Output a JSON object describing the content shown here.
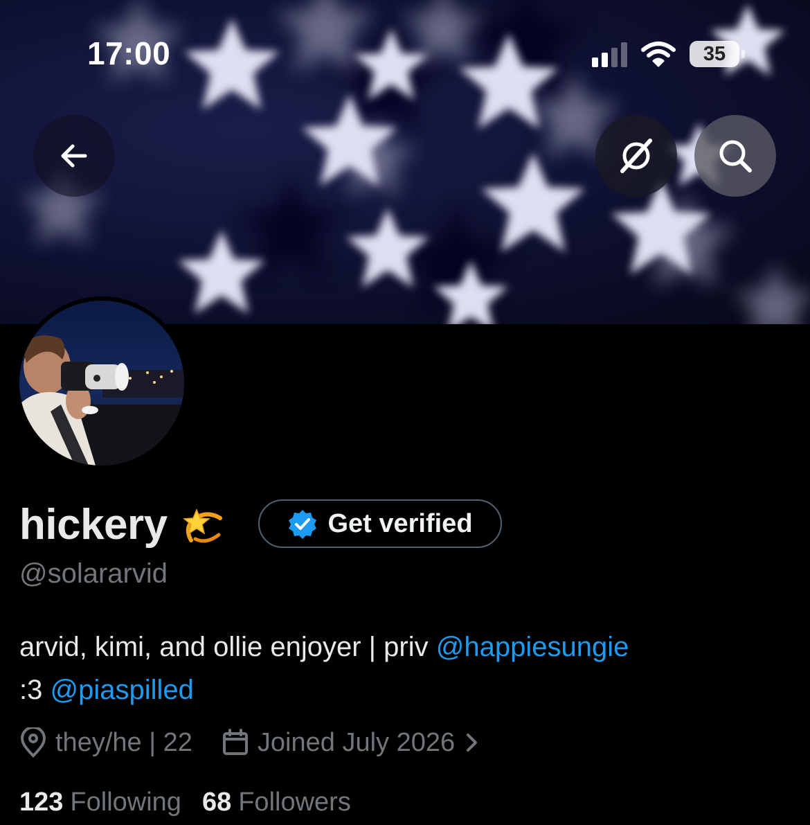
{
  "status_bar": {
    "time": "17:00",
    "battery_level": "35",
    "signal_icon": "cellular-signal-icon",
    "wifi_icon": "wifi-icon"
  },
  "header": {
    "back_icon": "arrow-left-icon",
    "grok_icon": "grok-icon",
    "search_icon": "search-icon"
  },
  "profile": {
    "display_name": "hickery",
    "name_emoji": "dizzy-star-emoji",
    "verify_button_label": "Get verified",
    "handle": "@solararvid",
    "bio": {
      "text_1": "arvid, kimi, and ollie enjoyer | priv ",
      "mention_1": "@happiesungie",
      "text_2": ":3 ",
      "mention_2": "@piaspilled"
    },
    "location": "they/he | 22",
    "joined": "Joined July 2026",
    "following_count": "123",
    "following_label": "Following",
    "followers_count": "68",
    "followers_label": "Followers"
  },
  "colors": {
    "background": "#000000",
    "accent": "#1d9bf0",
    "secondary_text": "#71767b",
    "verified_badge": "#1d9bf0"
  }
}
